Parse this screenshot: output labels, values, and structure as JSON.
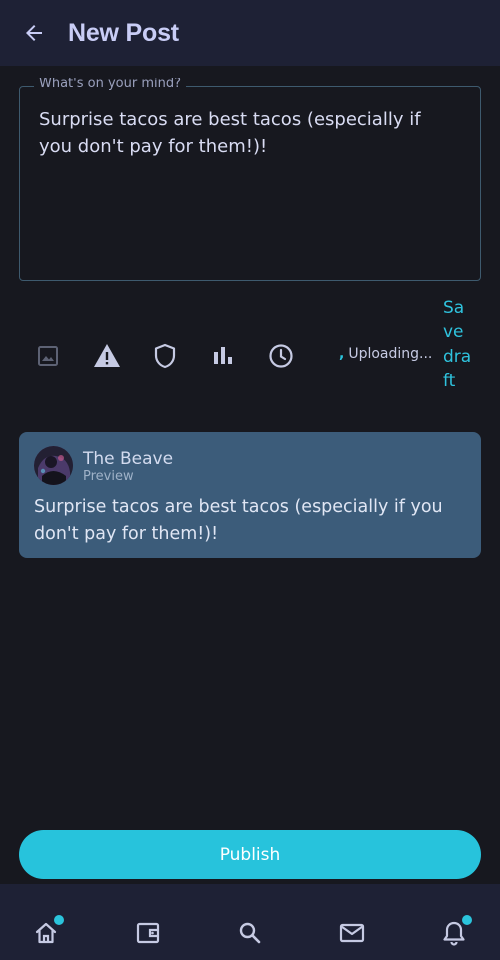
{
  "header": {
    "title": "New Post"
  },
  "composer": {
    "label": "What's on your mind?",
    "text": "Surprise tacos are best tacos (especially if you don't pay for them!)!"
  },
  "toolbar": {
    "icons": [
      "image-icon",
      "warning-icon",
      "shield-icon",
      "poll-icon",
      "clock-icon"
    ],
    "upload_status": "Uploading...",
    "save_draft_label": "Save draft"
  },
  "preview": {
    "name": "The Beave",
    "subtitle": "Preview",
    "text": "Surprise tacos are best tacos (especially if you don't pay for them!)!"
  },
  "publish_label": "Publish",
  "nav": {
    "items": [
      "home-icon",
      "wallet-icon",
      "search-icon",
      "mail-icon",
      "bell-icon"
    ],
    "badges": [
      "home",
      "notifications"
    ]
  },
  "colors": {
    "accent": "#27c3dc",
    "background": "#17181f",
    "header": "#1e2135",
    "preview_card": "#3c5c7a"
  }
}
